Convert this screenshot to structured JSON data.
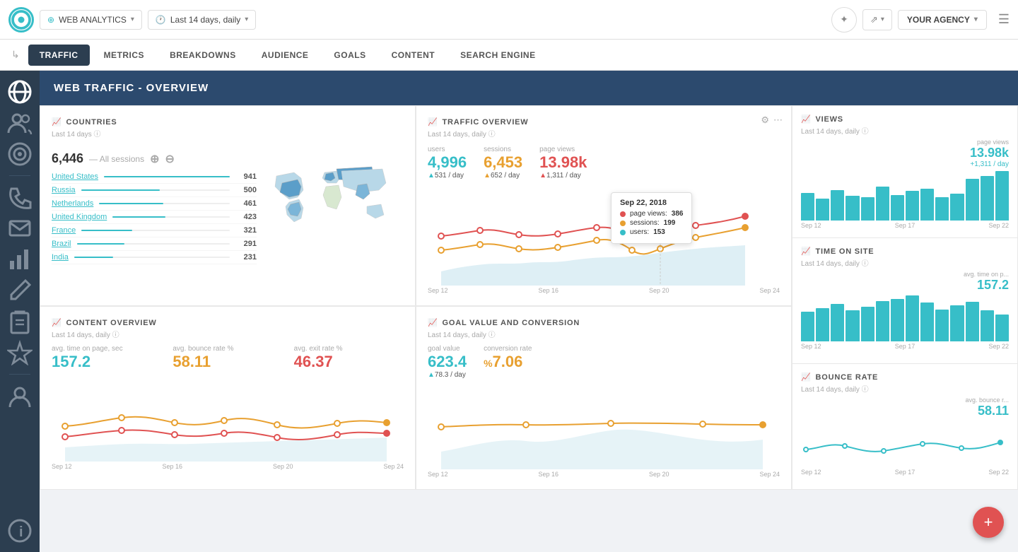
{
  "app": {
    "logo_letter": "○",
    "datasource_label": "WEB ANALYTICS",
    "date_range_label": "Last 14 days, daily",
    "agency_label": "YOUR AGENCY"
  },
  "tabs": [
    {
      "label": "TRAFFIC",
      "active": true
    },
    {
      "label": "METRICS",
      "active": false
    },
    {
      "label": "BREAKDOWNS",
      "active": false
    },
    {
      "label": "AUDIENCE",
      "active": false
    },
    {
      "label": "GOALS",
      "active": false
    },
    {
      "label": "CONTENT",
      "active": false
    },
    {
      "label": "SEARCH ENGINE",
      "active": false
    }
  ],
  "page_header": "WEB TRAFFIC - OVERVIEW",
  "sidebar_icons": [
    "globe",
    "users",
    "target",
    "phone",
    "at",
    "chart",
    "pencil",
    "clipboard",
    "star",
    "user",
    "info"
  ],
  "countries_card": {
    "title": "COUNTRIES",
    "subtitle": "Last 14 days",
    "total": "6,446",
    "total_label": "— All sessions",
    "countries": [
      {
        "name": "United States",
        "value": 941,
        "pct": 100
      },
      {
        "name": "Russia",
        "value": 500,
        "pct": 53
      },
      {
        "name": "Netherlands",
        "value": 461,
        "pct": 49
      },
      {
        "name": "United Kingdom",
        "value": 423,
        "pct": 45
      },
      {
        "name": "France",
        "value": 321,
        "pct": 34
      },
      {
        "name": "Brazil",
        "value": 291,
        "pct": 31
      },
      {
        "name": "India",
        "value": 231,
        "pct": 25
      }
    ]
  },
  "traffic_card": {
    "title": "TRAFFIC OVERVIEW",
    "subtitle": "Last 14 days, daily",
    "users": {
      "label": "users",
      "value": "4,996",
      "change": "531",
      "per": "day"
    },
    "sessions": {
      "label": "sessions",
      "value": "6,453",
      "change": "652",
      "per": "day"
    },
    "pageviews": {
      "label": "page views",
      "value": "13.98k",
      "change": "1,311",
      "per": "day"
    },
    "tooltip": {
      "date": "Sep 22, 2018",
      "pageviews": {
        "label": "page views:",
        "value": 386
      },
      "sessions": {
        "label": "sessions:",
        "value": 199
      },
      "users": {
        "label": "users:",
        "value": 153
      }
    },
    "dates": [
      "Sep 12",
      "Sep 16",
      "Sep 20",
      "Sep 24"
    ]
  },
  "views_card": {
    "title": "VIEWS",
    "subtitle": "Last 14 days, daily",
    "value": "13.98k",
    "change": "+1,311 / day",
    "pv_label": "page views",
    "dates": [
      "Sep 12",
      "Sep 17",
      "Sep 22"
    ],
    "bars": [
      45,
      35,
      50,
      40,
      38,
      55,
      42,
      48,
      52,
      38,
      44,
      68,
      72,
      80
    ]
  },
  "time_card": {
    "title": "TIME ON SITE",
    "subtitle": "Last 14 days, daily",
    "value": "157.2",
    "label": "avg. time on p...",
    "dates": [
      "Sep 12",
      "Sep 17",
      "Sep 22"
    ],
    "bars": [
      55,
      62,
      70,
      58,
      65,
      75,
      80,
      85,
      72,
      60,
      68,
      74,
      58,
      50
    ]
  },
  "bounce_card": {
    "title": "BOUNCE RATE",
    "subtitle": "Last 14 days, daily",
    "value": "58.11",
    "label": "avg. bounce r...",
    "dates": [
      "Sep 12",
      "Sep 17",
      "Sep 22"
    ]
  },
  "content_card": {
    "title": "CONTENT OVERVIEW",
    "subtitle": "Last 14 days, daily",
    "metrics": [
      {
        "label": "avg. time on page, sec",
        "value": "157.2",
        "color": "blue",
        "decimals": false
      },
      {
        "label": "avg. bounce rate %",
        "value": "58.11",
        "color": "orange",
        "decimals": true
      },
      {
        "label": "avg. exit rate %",
        "value": "46.37",
        "color": "red",
        "decimals": true
      }
    ],
    "dates": [
      "Sep 12",
      "Sep 16",
      "Sep 20",
      "Sep 24"
    ]
  },
  "goal_card": {
    "title": "GOAL VALUE AND CONVERSION",
    "subtitle": "Last 14 days, daily",
    "goal_value": {
      "label": "goal value",
      "value": "623.4",
      "change": "78.3",
      "per": "day"
    },
    "conversion": {
      "label": "conversion rate",
      "value": "7.06",
      "prefix": "%"
    },
    "dates": [
      "Sep 12",
      "Sep 16",
      "Sep 20",
      "Sep 24"
    ]
  }
}
